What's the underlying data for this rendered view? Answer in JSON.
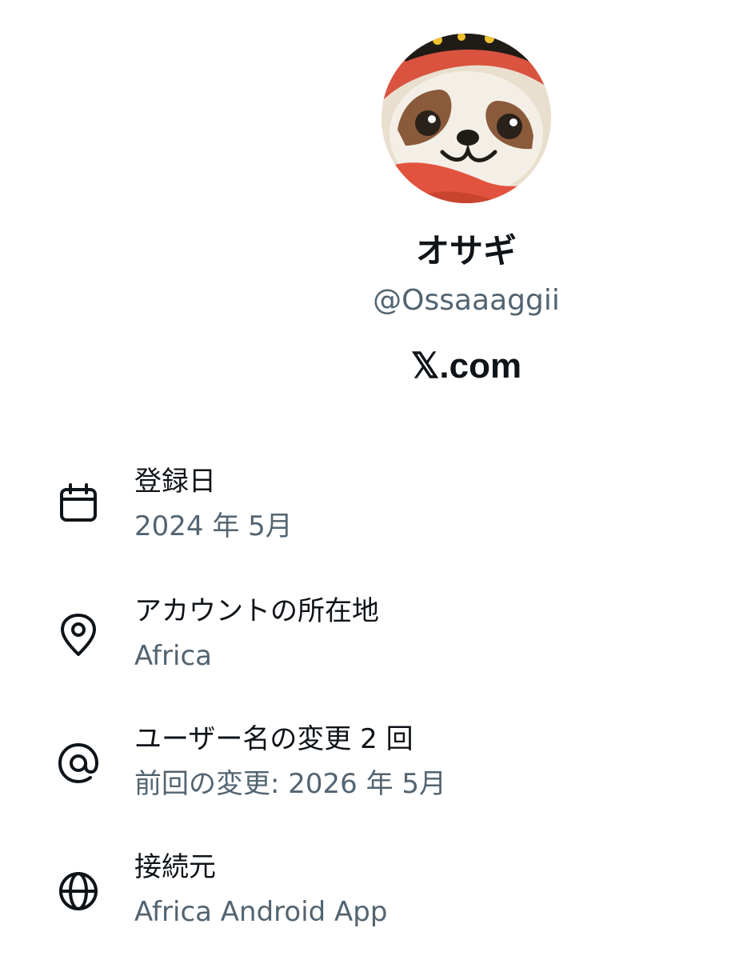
{
  "profile": {
    "display_name": "オサギ",
    "handle": "@Ossaaaggii",
    "site": "𝕏.com",
    "avatar_icon": "sloth-avatar"
  },
  "about": {
    "joined": {
      "icon": "calendar-icon",
      "title": "登録日",
      "value": "2024 年 5月"
    },
    "location": {
      "icon": "location-pin-icon",
      "title": "アカウントの所在地",
      "value": "Africa"
    },
    "username_changes": {
      "icon": "at-sign-icon",
      "title": "ユーザー名の変更 2 回",
      "value": "前回の変更: 2026 年 5月"
    },
    "connected_via": {
      "icon": "globe-icon",
      "title": "接続元",
      "value": "Africa Android App"
    }
  },
  "colors": {
    "primary_text": "#0f1419",
    "secondary_text": "#536471",
    "background": "#ffffff"
  }
}
